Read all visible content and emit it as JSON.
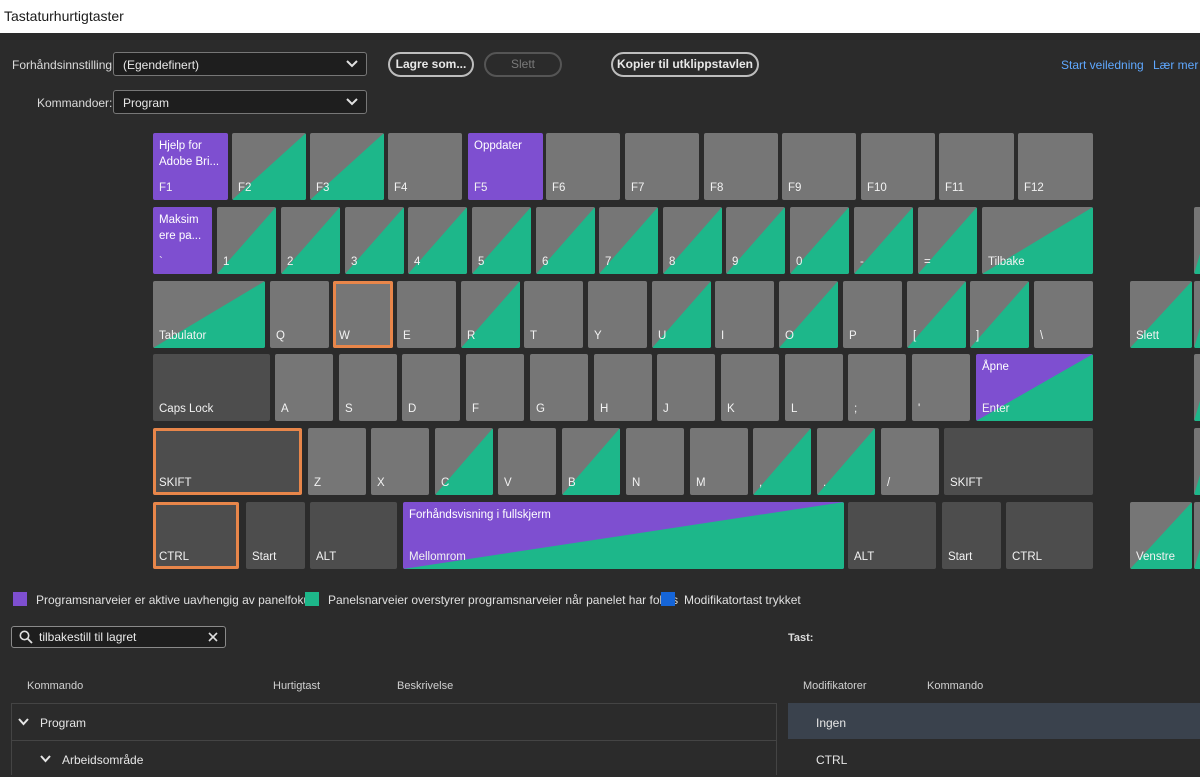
{
  "window": {
    "title": "Tastaturhurtigtaster"
  },
  "toolbar": {
    "preset_label": "Forhåndsinnstilling:",
    "preset_value": "(Egendefinert)",
    "commands_label": "Kommandoer:",
    "commands_value": "Program",
    "save_as": "Lagre som...",
    "delete": "Slett",
    "copy_clipboard": "Kopier til utklippstavlen",
    "start_tutorial": "Start veiledning",
    "learn_more": "Lær mer"
  },
  "colors": {
    "purple": "#7e4fd0",
    "green": "#1db78a",
    "blue": "#1565d8",
    "key_gray": "#767676",
    "key_dark": "#4d4d4d",
    "selected_outline": "#e8864a"
  },
  "keyboard": {
    "rows": [
      [
        {
          "label": "F1",
          "cmd": "Hjelp for Adobe Bri...",
          "type": "purple"
        },
        {
          "label": "F2",
          "type": "split"
        },
        {
          "label": "F3",
          "type": "split"
        },
        {
          "label": "F4",
          "type": "gray"
        },
        {
          "label": "F5",
          "cmd": "Oppdater",
          "type": "purple"
        },
        {
          "label": "F6",
          "type": "gray"
        },
        {
          "label": "F7",
          "type": "gray"
        },
        {
          "label": "F8",
          "type": "gray"
        },
        {
          "label": "F9",
          "type": "gray"
        },
        {
          "label": "F10",
          "type": "gray"
        },
        {
          "label": "F11",
          "type": "gray"
        },
        {
          "label": "F12",
          "type": "gray"
        }
      ],
      [
        {
          "label": "`",
          "cmd": "Maksim ere pa...",
          "type": "purple"
        },
        {
          "label": "1",
          "type": "split"
        },
        {
          "label": "2",
          "type": "split"
        },
        {
          "label": "3",
          "type": "split"
        },
        {
          "label": "4",
          "type": "split"
        },
        {
          "label": "5",
          "type": "split"
        },
        {
          "label": "6",
          "type": "split"
        },
        {
          "label": "7",
          "type": "split"
        },
        {
          "label": "8",
          "type": "split"
        },
        {
          "label": "9",
          "type": "split"
        },
        {
          "label": "0",
          "type": "split"
        },
        {
          "label": "-",
          "type": "split"
        },
        {
          "label": "=",
          "type": "split"
        },
        {
          "label": "Tilbake",
          "type": "split"
        },
        {
          "label": "",
          "type": "split"
        }
      ],
      [
        {
          "label": "Tabulator",
          "type": "split"
        },
        {
          "label": "Q",
          "type": "gray"
        },
        {
          "label": "W",
          "type": "gray"
        },
        {
          "label": "E",
          "type": "gray"
        },
        {
          "label": "R",
          "type": "split"
        },
        {
          "label": "T",
          "type": "gray"
        },
        {
          "label": "Y",
          "type": "gray"
        },
        {
          "label": "U",
          "type": "split"
        },
        {
          "label": "I",
          "type": "gray"
        },
        {
          "label": "O",
          "type": "split"
        },
        {
          "label": "P",
          "type": "gray"
        },
        {
          "label": "[",
          "type": "split"
        },
        {
          "label": "]",
          "type": "split"
        },
        {
          "label": "\\",
          "type": "gray"
        },
        {
          "label": "Slett",
          "type": "split"
        },
        {
          "label": "",
          "type": "split"
        }
      ],
      [
        {
          "label": "Caps Lock",
          "type": "dark"
        },
        {
          "label": "A",
          "type": "gray"
        },
        {
          "label": "S",
          "type": "gray"
        },
        {
          "label": "D",
          "type": "gray"
        },
        {
          "label": "F",
          "type": "gray"
        },
        {
          "label": "G",
          "type": "gray"
        },
        {
          "label": "H",
          "type": "gray"
        },
        {
          "label": "J",
          "type": "gray"
        },
        {
          "label": "K",
          "type": "gray"
        },
        {
          "label": "L",
          "type": "gray"
        },
        {
          "label": ";",
          "type": "gray"
        },
        {
          "label": "'",
          "type": "gray"
        },
        {
          "label": "Enter",
          "cmd": "Åpne",
          "type": "purple-split"
        },
        {
          "label": "",
          "type": "split"
        }
      ],
      [
        {
          "label": "SKIFT",
          "type": "dark"
        },
        {
          "label": "Z",
          "type": "gray"
        },
        {
          "label": "X",
          "type": "gray"
        },
        {
          "label": "C",
          "type": "split"
        },
        {
          "label": "V",
          "type": "gray"
        },
        {
          "label": "B",
          "type": "split"
        },
        {
          "label": "N",
          "type": "gray"
        },
        {
          "label": "M",
          "type": "gray"
        },
        {
          "label": ",",
          "type": "split"
        },
        {
          "label": ".",
          "type": "split"
        },
        {
          "label": "/",
          "type": "gray"
        },
        {
          "label": "SKIFT",
          "type": "dark"
        },
        {
          "label": "",
          "type": "split"
        }
      ],
      [
        {
          "label": "CTRL",
          "type": "dark"
        },
        {
          "label": "Start",
          "type": "dark"
        },
        {
          "label": "ALT",
          "type": "dark"
        },
        {
          "label": "Mellomrom",
          "cmd": "Forhåndsvisning i fullskjerm",
          "type": "purple-split"
        },
        {
          "label": "ALT",
          "type": "dark"
        },
        {
          "label": "Start",
          "type": "dark"
        },
        {
          "label": "CTRL",
          "type": "dark"
        },
        {
          "label": "Venstre",
          "type": "split"
        },
        {
          "label": "",
          "type": "split"
        }
      ]
    ]
  },
  "legend": [
    {
      "text": "Programsnarveier er aktive uavhengig av panelfokus"
    },
    {
      "text": "Panelsnarveier overstyrer programsnarveier når panelet har fokus"
    },
    {
      "text": "Modifikatortast trykket"
    }
  ],
  "search": {
    "value": "tilbakestill til lagret"
  },
  "table": {
    "headers": [
      "Kommando",
      "Hurtigtast",
      "Beskrivelse"
    ],
    "rows": [
      {
        "label": "Program"
      },
      {
        "label": "Arbeidsområde"
      }
    ]
  },
  "key_panel": {
    "label": "Tast:",
    "headers": [
      "Modifikatorer",
      "Kommando"
    ],
    "rows": [
      {
        "label": "Ingen",
        "selected": true
      },
      {
        "label": "CTRL",
        "selected": false
      }
    ]
  }
}
